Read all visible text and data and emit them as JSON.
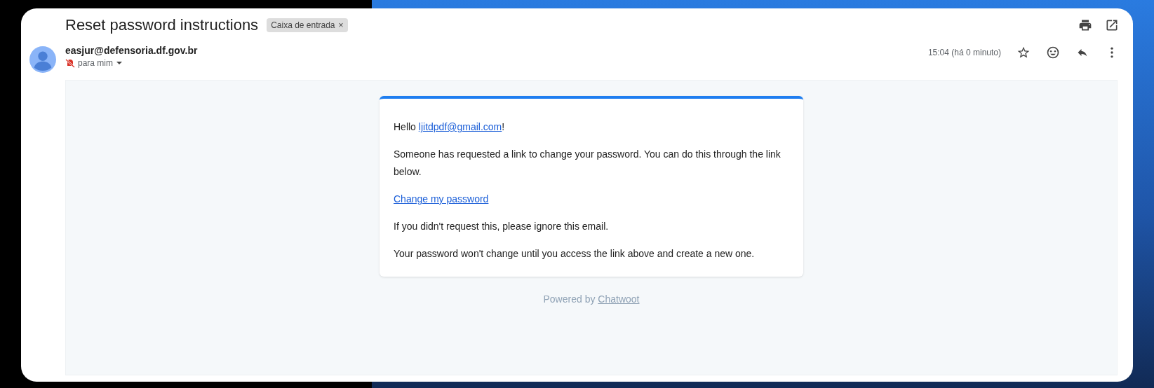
{
  "email": {
    "subject": "Reset password instructions",
    "labels": [
      {
        "text": "Caixa de entrada",
        "close": "×"
      }
    ],
    "sender": "easjur@defensoria.df.gov.br",
    "recipient": "para mim",
    "time": "15:04 (há 0 minuto)",
    "starred": false
  },
  "message": {
    "greeting_before": "Hello ",
    "greeting_email": "ljitdpdf@gmail.com",
    "greeting_after": "!",
    "paragraphs": [
      {
        "kind": "text",
        "text": "Someone has requested a link to change your password. You can do this through the link below."
      },
      {
        "kind": "link",
        "text": "Change my password"
      },
      {
        "kind": "text",
        "text": "If you didn't request this, please ignore this email."
      },
      {
        "kind": "text",
        "text": "Your password won't change until you access the link above and create a new one."
      }
    ]
  },
  "footer": {
    "text": "Powered by ",
    "link": "Chatwoot"
  }
}
